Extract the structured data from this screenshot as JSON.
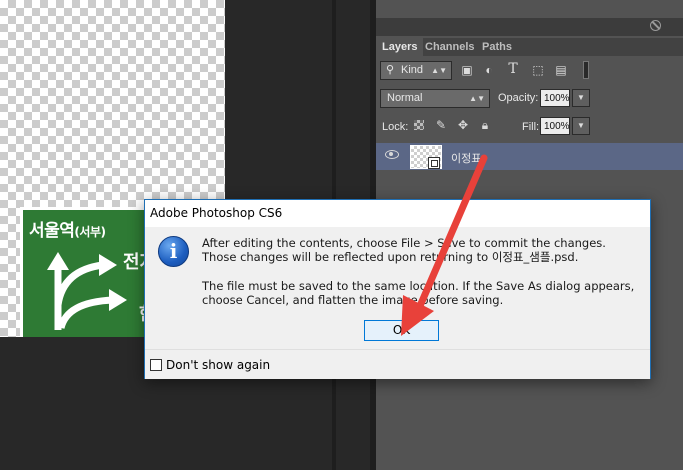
{
  "canvas": {
    "sign": {
      "title": "서울역",
      "subtitle": "(서부)",
      "dest1": "전지",
      "dest2": "한"
    }
  },
  "layers_panel": {
    "tabs": [
      {
        "label": "Layers",
        "active": true
      },
      {
        "label": "Channels",
        "active": false
      },
      {
        "label": "Paths",
        "active": false
      }
    ],
    "filter": {
      "label": "Kind"
    },
    "blend_mode": "Normal",
    "opacity_label": "Opacity:",
    "opacity_value": "100%",
    "lock_label": "Lock:",
    "fill_label": "Fill:",
    "fill_value": "100%",
    "layer": {
      "name": "이정표"
    }
  },
  "dialog": {
    "title": "Adobe Photoshop CS6",
    "message1": "After editing the contents, choose File > Save to commit the changes.  Those changes will be reflected upon returning to 이정표_샘플.psd.",
    "message2": "The file must be saved to the same location. If the Save As dialog appears, choose Cancel, and flatten the image before saving.",
    "ok_label": "OK",
    "dont_show_label": "Don't show again",
    "dont_show_checked": false
  },
  "colors": {
    "panel_bg": "#535353",
    "selected_layer": "#5b6786",
    "sign_green": "#2e7a34",
    "arrow_red": "#e8413a"
  },
  "icons": {
    "info": "info-icon",
    "eye": "eye-icon",
    "no_entry": "no-entry-icon"
  }
}
